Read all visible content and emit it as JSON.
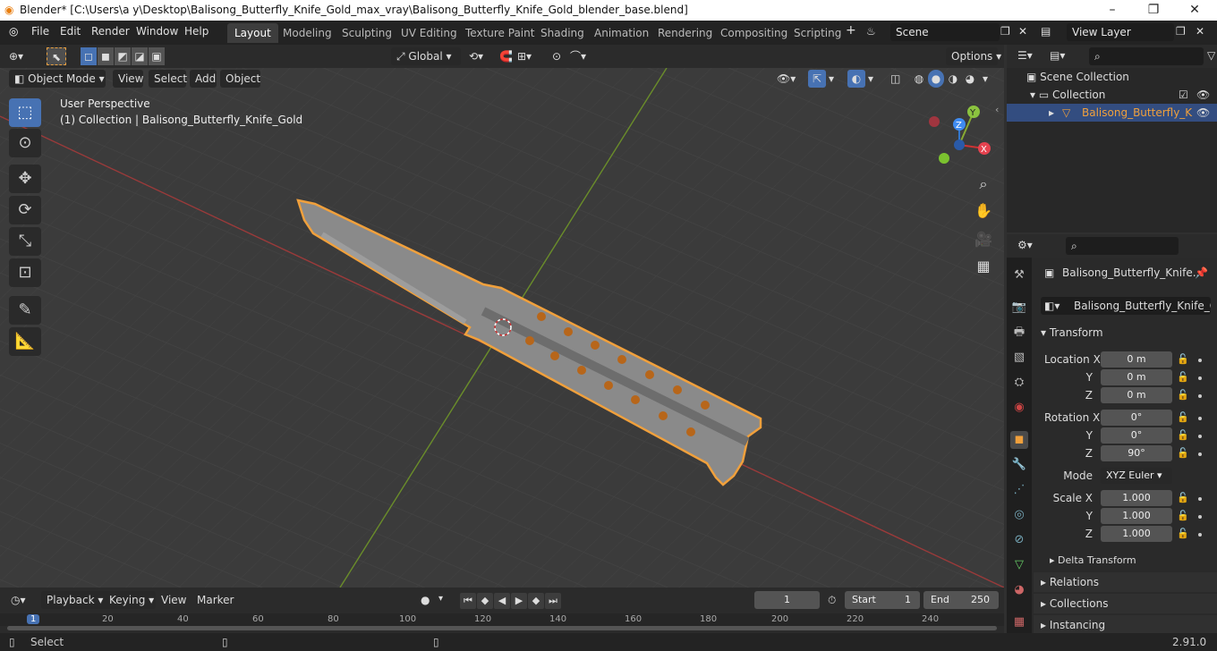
{
  "titlebar": {
    "title": "Blender* [C:\\Users\\a y\\Desktop\\Balisong_Butterfly_Knife_Gold_max_vray\\Balisong_Butterfly_Knife_Gold_blender_base.blend]"
  },
  "menu": [
    "File",
    "Edit",
    "Render",
    "Window",
    "Help"
  ],
  "workspaces": [
    "Layout",
    "Modeling",
    "Sculpting",
    "UV Editing",
    "Texture Paint",
    "Shading",
    "Animation",
    "Rendering",
    "Compositing",
    "Scripting"
  ],
  "active_workspace": "Layout",
  "scene": "Scene",
  "view_layer": "View Layer",
  "viewport_header": {
    "transform": "Global",
    "options": "Options"
  },
  "viewport_menu": {
    "mode": "Object Mode",
    "items": [
      "View",
      "Select",
      "Add",
      "Object"
    ]
  },
  "viewport_overlay": {
    "perspective": "User Perspective",
    "collection": "(1) Collection | Balisong_Butterfly_Knife_Gold"
  },
  "gizmo": {
    "x": "X",
    "y": "Y",
    "z": "Z"
  },
  "outliner": {
    "root": "Scene Collection",
    "collection": "Collection",
    "object": "Balisong_Butterfly_K"
  },
  "properties": {
    "object_header": "Balisong_Butterfly_Knife...",
    "object_name": "Balisong_Butterfly_Knife_Gold",
    "transform_label": "Transform",
    "location_x_label": "Location X",
    "location_x": "0 m",
    "location_y_label": "Y",
    "location_y": "0 m",
    "location_z_label": "Z",
    "location_z": "0 m",
    "rotation_x_label": "Rotation X",
    "rotation_x": "0°",
    "rotation_y_label": "Y",
    "rotation_y": "0°",
    "rotation_z_label": "Z",
    "rotation_z": "90°",
    "mode_label": "Mode",
    "mode": "XYZ Euler",
    "scale_x_label": "Scale X",
    "scale_x": "1.000",
    "scale_y_label": "Y",
    "scale_y": "1.000",
    "scale_z_label": "Z",
    "scale_z": "1.000",
    "delta": "Delta Transform",
    "relations": "Relations",
    "collections": "Collections",
    "instancing": "Instancing"
  },
  "timeline": {
    "menus": [
      "Playback",
      "Keying",
      "View",
      "Marker"
    ],
    "current_frame": "1",
    "start_label": "Start",
    "start": "1",
    "end_label": "End",
    "end": "250",
    "ruler": [
      "1",
      "20",
      "40",
      "60",
      "80",
      "100",
      "120",
      "140",
      "160",
      "180",
      "200",
      "220",
      "240"
    ]
  },
  "status": {
    "select": "Select",
    "version": "2.91.0"
  }
}
